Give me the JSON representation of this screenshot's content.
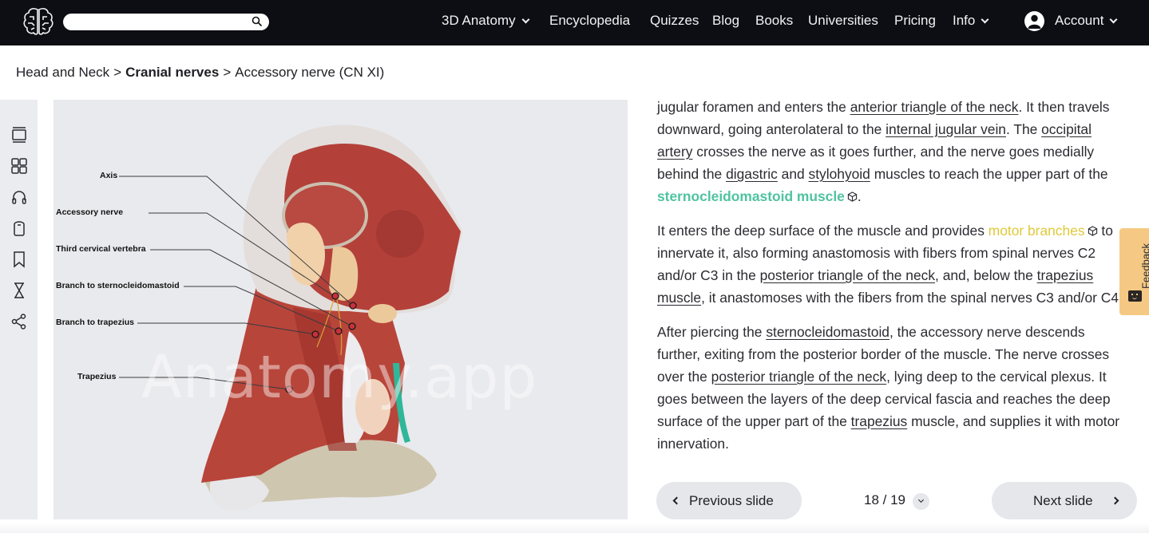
{
  "header": {
    "logo_icon": "brain-icon",
    "search": {
      "value": "",
      "placeholder": "",
      "icon": "search-icon"
    },
    "nav": [
      {
        "label": "3D Anatomy",
        "dropdown": true
      },
      {
        "label": "Encyclopedia",
        "dropdown": false
      },
      {
        "label": "Quizzes",
        "dropdown": false
      },
      {
        "label": "Blog",
        "dropdown": false
      },
      {
        "label": "Books",
        "dropdown": false
      },
      {
        "label": "Universities",
        "dropdown": false
      },
      {
        "label": "Pricing",
        "dropdown": false
      },
      {
        "label": "Info",
        "dropdown": true
      }
    ],
    "account": {
      "label": "Account",
      "icon": "user-avatar-icon",
      "dropdown": true
    }
  },
  "breadcrumb": {
    "items": [
      "Head and Neck",
      "Cranial nerves",
      "Accessory nerve (CN XI)"
    ],
    "separator": ">"
  },
  "toolbar": {
    "tools": [
      {
        "name": "slides-icon"
      },
      {
        "name": "grid-icon"
      },
      {
        "name": "headphones-icon"
      },
      {
        "name": "flashcard-icon"
      },
      {
        "name": "bookmark-icon"
      },
      {
        "name": "hourglass-icon"
      },
      {
        "name": "share-icon"
      }
    ]
  },
  "figure": {
    "watermark": "Anatomy.app",
    "labels": [
      "Axis",
      "Accessory nerve",
      "Third cervical vertebra",
      "Branch to sternocleidomastoid",
      "Branch to trapezius",
      "Trapezius"
    ]
  },
  "article": {
    "p1": {
      "t1": "jugular foramen and enters the ",
      "l1": "anterior triangle of the neck",
      "t2": ". It then travels downward, going anterolateral to the ",
      "l2": "internal jugular vein",
      "t3": ". The ",
      "l3": "occipital artery",
      "t4": " crosses the nerve as it goes further, and the nerve goes medially behind the ",
      "l4": "digastric",
      "t5": " and ",
      "l5": "stylohyoid",
      "t6": " muscles to reach the upper part of the ",
      "l6": "sternocleidomastoid muscle",
      "t7": "."
    },
    "p2": {
      "t1": "It enters the deep surface of the muscle and provides ",
      "l1": "motor branches",
      "t2": " to innervate it, also forming anastomosis with fibers from spinal nerves C2 and/or C3 in the ",
      "l2": "posterior triangle of the neck",
      "t3": ", and, below the ",
      "l3": "trapezius muscle",
      "t4": ", it anastomoses with the fibers from the spinal nerves C3 and/or C4."
    },
    "p3": {
      "t1": "After piercing the ",
      "l1": "sternocleidomastoid",
      "t2": ", the accessory nerve descends further, exiting from the posterior border of the muscle. The nerve crosses over the ",
      "l2": "posterior triangle of the neck",
      "t3": ", lying deep to the cervical plexus. It goes between the layers of the deep cervical fascia and reaches the deep surface of the upper part of the ",
      "l3": "trapezius",
      "t4": " muscle, and supplies it with motor innervation."
    },
    "colors": {
      "model_link": "#4fc3a1",
      "highlight_link": "#e0c93a"
    }
  },
  "pagination": {
    "prev_label": "Previous slide",
    "next_label": "Next slide",
    "current": 18,
    "total": 19,
    "display": "18 / 19"
  },
  "feedback": {
    "label": "Feedback",
    "color": "#f5c983"
  }
}
